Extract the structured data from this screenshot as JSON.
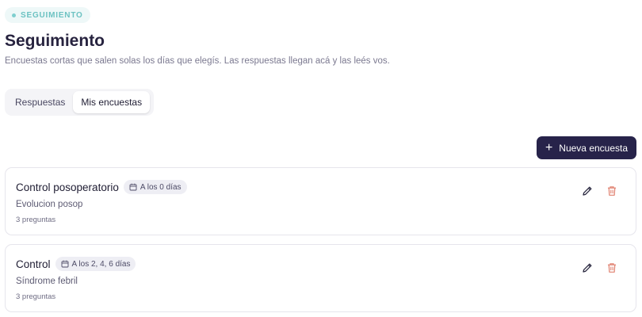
{
  "header": {
    "badge": "SEGUIMIENTO",
    "title": "Seguimiento",
    "subtitle": "Encuestas cortas que salen solas los días que elegís. Las respuestas llegan acá y las leés vos."
  },
  "tabs": [
    {
      "label": "Respuestas",
      "active": false
    },
    {
      "label": "Mis encuestas",
      "active": true
    }
  ],
  "new_button": {
    "label": "Nueva encuesta",
    "icon": "plus-icon"
  },
  "surveys": [
    {
      "name": "Control posoperatorio",
      "schedule": "A los 0 días",
      "description": "Evolucion posop",
      "questions": "3 preguntas"
    },
    {
      "name": "Control",
      "schedule": "A los 2, 4, 6 días",
      "description": "Síndrome febril",
      "questions": "3 preguntas"
    }
  ],
  "colors": {
    "accent": "#27234a",
    "badge_bg": "#eef8f8",
    "badge_text": "#6cc2c2",
    "delete": "#e0806f"
  }
}
